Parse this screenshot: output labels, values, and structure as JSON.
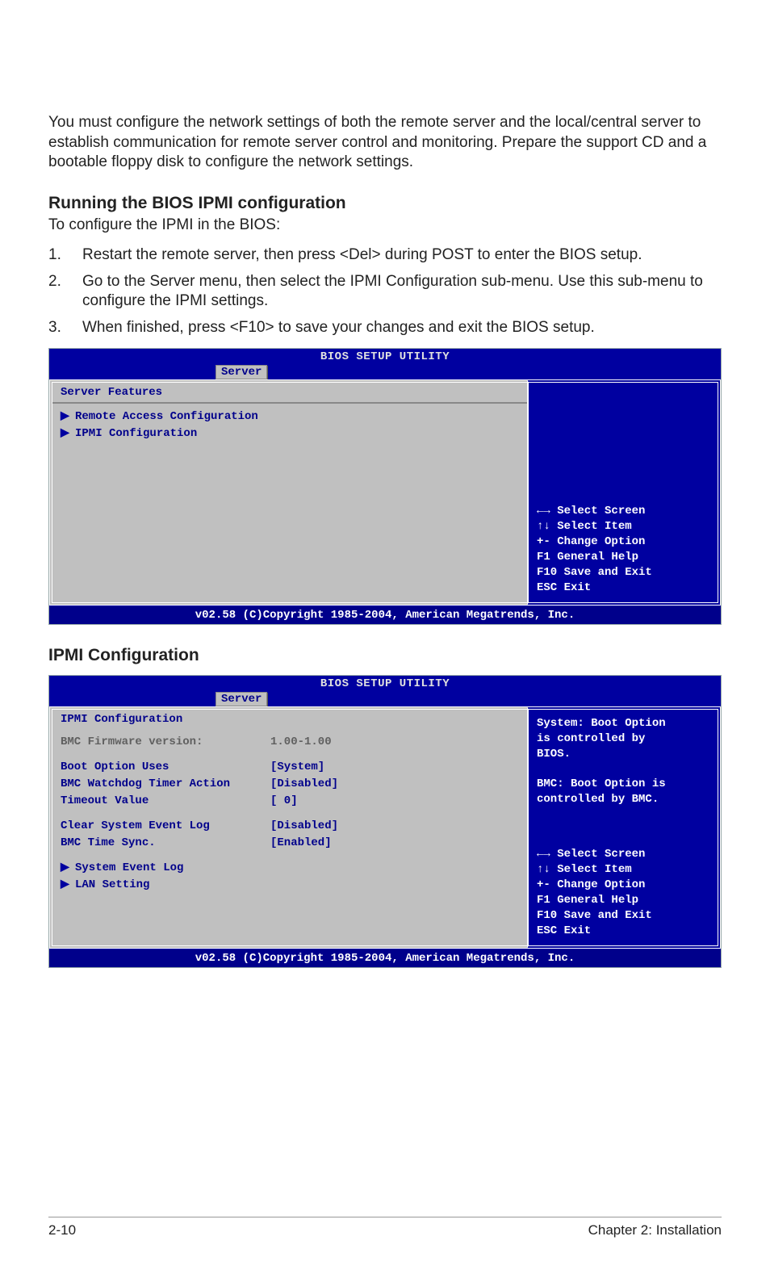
{
  "intro": "You must configure the network settings of both the remote server and the local/central server to establish communication for remote server control and monitoring. Prepare the support CD and a bootable floppy disk to configure the network settings.",
  "section1_heading": "Running the BIOS IPMI configuration",
  "section1_lead": "To configure the IPMI in the BIOS:",
  "steps": [
    "Restart the remote server, then press <Del> during POST to enter the BIOS setup.",
    "Go to the Server menu, then select the IPMI Configuration sub-menu. Use this sub-menu to configure the IPMI settings.",
    "When finished, press <F10> to save your changes and exit the BIOS setup."
  ],
  "bios_common": {
    "title": "BIOS SETUP UTILITY",
    "tab": "Server",
    "footer": "v02.58 (C)Copyright 1985-2004, American Megatrends, Inc.",
    "help_keys": [
      "←→ Select Screen",
      "↑↓  Select Item",
      "+-  Change Option",
      "F1  General Help",
      "F10 Save and Exit",
      "ESC Exit"
    ]
  },
  "bios1": {
    "section_title": "Server Features",
    "items": [
      {
        "arrow": true,
        "label": "Remote Access Configuration"
      },
      {
        "arrow": true,
        "label": "IPMI Configuration"
      }
    ]
  },
  "section2_heading": "IPMI Configuration",
  "bios2": {
    "section_title": "IPMI Configuration",
    "firmware_label": "BMC Firmware version:",
    "firmware_value": "1.00-1.00",
    "rows": [
      {
        "label": "Boot Option Uses",
        "value": "[System]"
      },
      {
        "label": "BMC Watchdog Timer Action",
        "value": "[Disabled]"
      },
      {
        "label": "Timeout Value",
        "value": "[  0]"
      }
    ],
    "rows2": [
      {
        "label": "Clear System Event Log",
        "value": "[Disabled]"
      },
      {
        "label": "BMC Time Sync.",
        "value": "[Enabled]"
      }
    ],
    "sub_items": [
      {
        "arrow": true,
        "label": "System Event Log"
      },
      {
        "arrow": true,
        "label": "LAN Setting"
      }
    ],
    "help_top": [
      "System: Boot Option",
      "is controlled by",
      "BIOS.",
      "",
      "BMC: Boot Option is",
      "controlled by BMC."
    ]
  },
  "footer": {
    "left": "2-10",
    "right": "Chapter 2: Installation"
  }
}
